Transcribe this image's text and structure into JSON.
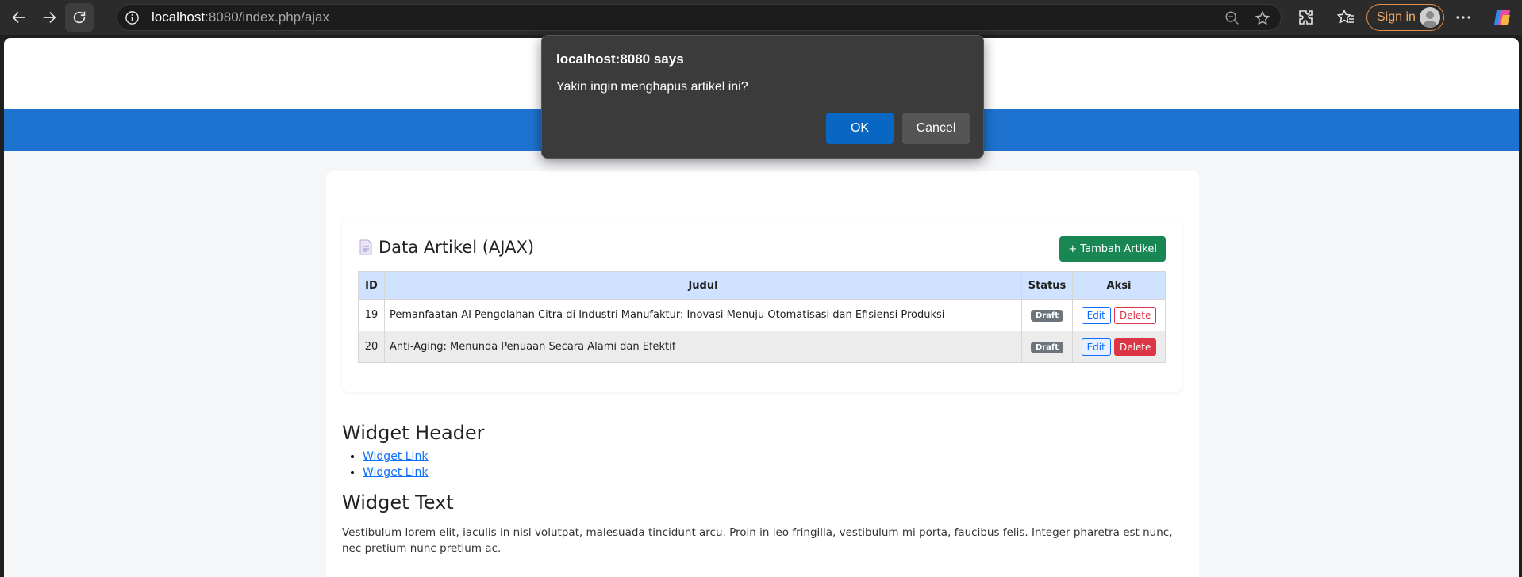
{
  "browser": {
    "url_host": "localhost",
    "url_rest": ":8080/index.php/ajax",
    "sign_in_label": "Sign in",
    "icons": [
      "back-icon",
      "forward-icon",
      "refresh-icon",
      "info-icon",
      "zoom-icon",
      "favorite-star-icon",
      "extensions-icon",
      "favorites-icon",
      "profile-avatar-icon",
      "more-icon",
      "copilot-icon"
    ]
  },
  "articles_card": {
    "title": "Data Artikel (AJAX)",
    "add_button": "+ Tambah Artikel",
    "columns": [
      "ID",
      "Judul",
      "Status",
      "Aksi"
    ],
    "rows": [
      {
        "id": "19",
        "title": "Pemanfaatan AI Pengolahan Citra di Industri Manufaktur: Inovasi Menuju Otomatisasi dan Efisiensi Produksi",
        "status": "Draft",
        "edit": "Edit",
        "delete": "Delete"
      },
      {
        "id": "20",
        "title": "Anti-Aging: Menunda Penuaan Secara Alami dan Efektif",
        "status": "Draft",
        "edit": "Edit",
        "delete": "Delete"
      }
    ]
  },
  "widgets": {
    "header_title": "Widget Header",
    "links": [
      "Widget Link",
      "Widget Link"
    ],
    "text_title": "Widget Text",
    "text_body": "Vestibulum lorem elit, iaculis in nisl volutpat, malesuada tincidunt arcu. Proin in leo fringilla, vestibulum mi porta, faucibus felis. Integer pharetra est nunc, nec pretium nunc pretium ac."
  },
  "dialog": {
    "title": "localhost:8080 says",
    "message": "Yakin ingin menghapus artikel ini?",
    "ok": "OK",
    "cancel": "Cancel"
  },
  "colors": {
    "nav_blue": "#1e73d0",
    "success_green": "#198754",
    "danger_red": "#dc3545",
    "primary_blue": "#0d6efd",
    "table_header": "#cfe2ff",
    "dialog_ok": "#0867c2"
  }
}
